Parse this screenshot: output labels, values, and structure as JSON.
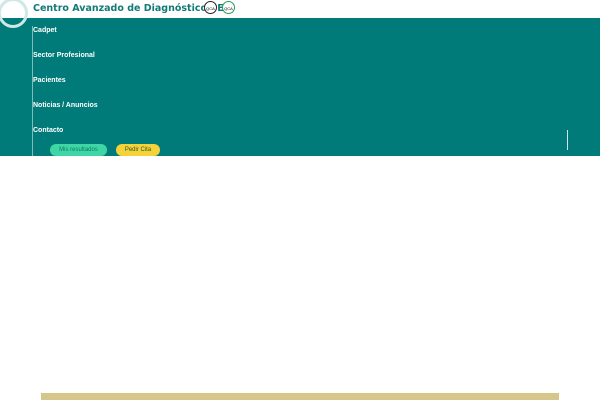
{
  "header": {
    "title": "Centro Avanzado de Diagnóstico PET",
    "badges": [
      "QCA",
      "QCA"
    ]
  },
  "nav": {
    "items": [
      "Cadpet",
      "Sector Profesional",
      "Pacientes",
      "Noticias / Anuncios",
      "Contacto"
    ],
    "buttons": {
      "results": "Mis resultados",
      "appointment": "Pedir Cita"
    }
  }
}
